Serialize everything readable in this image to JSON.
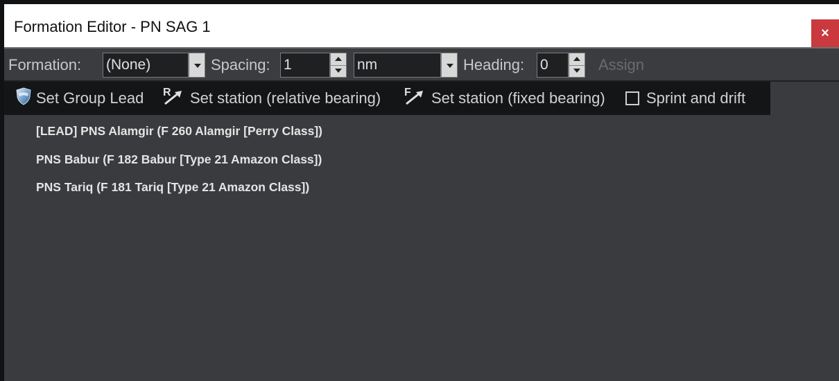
{
  "window": {
    "title": "Formation Editor - PN SAG 1",
    "close_label": "×"
  },
  "toolbar": {
    "formation_label": "Formation:",
    "formation_value": "(None)",
    "spacing_label": "Spacing:",
    "spacing_value": "1",
    "unit_value": "nm",
    "heading_label": "Heading:",
    "heading_value": "0",
    "assign_label": "Assign"
  },
  "actions": {
    "set_group_lead": "Set Group Lead",
    "set_station_relative": "Set station (relative bearing)",
    "set_station_fixed": "Set station (fixed bearing)",
    "sprint_and_drift": "Sprint and drift",
    "relative_icon_letter": "R",
    "fixed_icon_letter": "F"
  },
  "units": [
    "[LEAD] PNS Alamgir (F 260 Alamgir [Perry Class])",
    "PNS Babur (F 182 Babur [Type 21 Amazon Class])",
    "PNS Tariq (F 181 Tariq [Type 21 Amazon Class])"
  ],
  "colors": {
    "close_button": "#c9393e",
    "background": "#3a3b3e",
    "action_bar": "#141517"
  },
  "icons": {
    "group_lead": "shield-icon",
    "relative": "relative-bearing-arrow-icon",
    "fixed": "fixed-bearing-arrow-icon"
  }
}
